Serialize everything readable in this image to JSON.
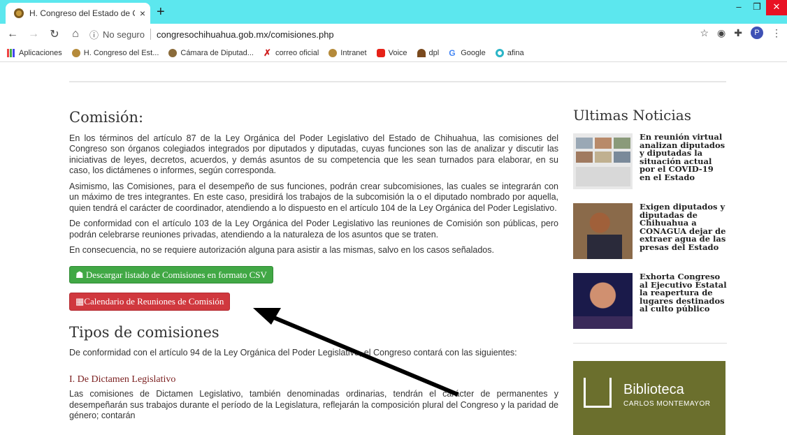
{
  "browser": {
    "tab_title": "H. Congreso del Estado de Chihu",
    "tab_close": "×",
    "new_tab": "+",
    "security_label": "No seguro",
    "url": "congresochihuahua.gob.mx/comisiones.php",
    "profile_initial": "P",
    "bookmarks": [
      "Aplicaciones",
      "H. Congreso del Est...",
      "Cámara de Diputad...",
      "correo oficial",
      "Intranet",
      "Voice",
      "dpl",
      "Google",
      "afina"
    ]
  },
  "main": {
    "title": "Comisión:",
    "paragraphs": [
      "En los términos del artículo 87 de la Ley Orgánica del Poder Legislativo del Estado de Chihuahua, las comisiones del Congreso son órganos colegiados integrados por diputados y diputadas, cuyas funciones son las de analizar y discutir las iniciativas de leyes, decretos, acuerdos, y demás asuntos de su competencia que les sean turnados para elaborar, en su caso, los dictámenes o informes, según corresponda.",
      "Asimismo, las Comisiones, para el desempeño de sus funciones, podrán crear subcomisiones, las cuales se integrarán con un máximo de tres integrantes. En este caso, presidirá los trabajos de la subcomisión la o el diputado nombrado por aquella, quien tendrá el carácter de coordinador, atendiendo a lo dispuesto en el artículo 104 de la Ley Orgánica del Poder Legislativo.",
      "De conformidad con el artículo 103 de la Ley Orgánica del Poder Legislativo las reuniones de Comisión son públicas, pero podrán celebrarse reuniones privadas, atendiendo a la naturaleza de los asuntos que se traten.",
      "En consecuencia, no se requiere autorización alguna para asistir a las mismas, salvo en los casos señalados."
    ],
    "btn_csv": "Descargar listado de Comisiones en formato CSV",
    "btn_calendar": "Calendario de Reuniones de Comisión",
    "tipos_title": "Tipos de comisiones",
    "tipos_intro": "De conformidad con el artículo 94 de la Ley Orgánica del Poder Legislativo, el Congreso contará con las siguientes:",
    "section1_title": "I. De Dictamen Legislativo",
    "section1_text": "Las comisiones de Dictamen Legislativo, también denominadas ordinarias, tendrán el carácter de permanentes y desempeñarán sus trabajos durante el período de la Legislatura, reflejarán la composición plural del Congreso y la paridad de género; contarán"
  },
  "sidebar": {
    "title": "Ultimas Noticias",
    "news": [
      "En reunión virtual analizan diputados y diputadas la situación actual por el COVID-19 en el Estado",
      "Exigen diputados y diputadas de Chihuahua a CONAGUA dejar de extraer agua de las presas del Estado",
      "Exhorta Congreso al Ejecutivo Estatal la reapertura de lugares destinados al culto público"
    ],
    "banner_title": "Biblioteca",
    "banner_subtitle": "CARLOS MONTEMAYOR"
  },
  "colors": {
    "tabstrip": "#5ce7ee",
    "green_button": "#41a845",
    "red_button": "#d0383e",
    "section_heading": "#7a1e1e"
  }
}
